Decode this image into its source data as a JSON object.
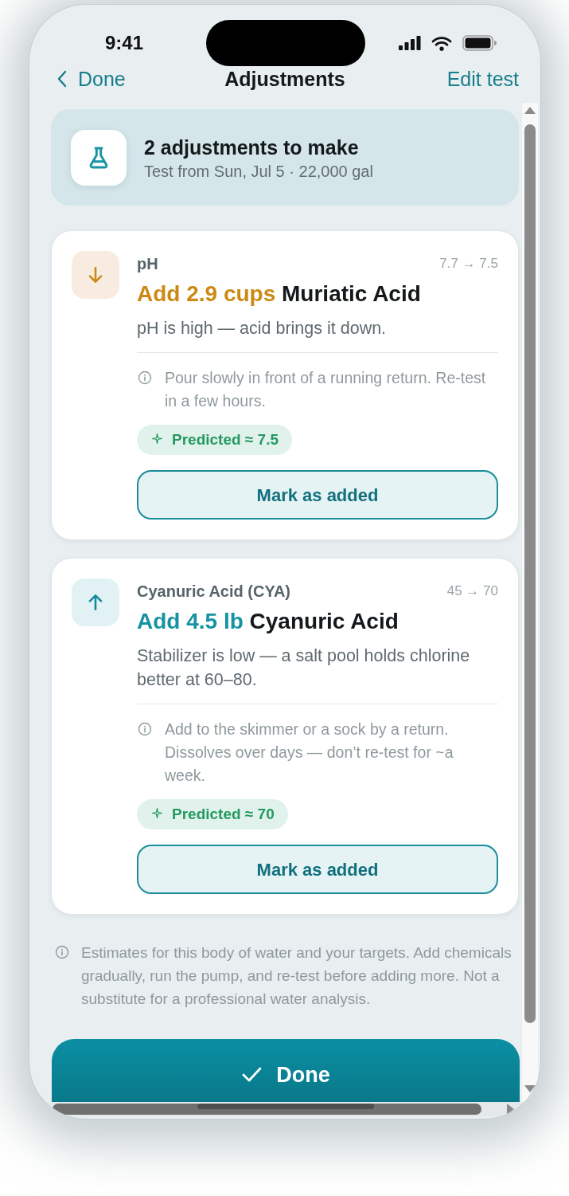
{
  "status_bar": {
    "time": "9:41"
  },
  "nav": {
    "back_label": "Done",
    "title": "Adjustments",
    "action": "Edit test"
  },
  "summary": {
    "title": "2 adjustments to make",
    "subtitle": "Test from Sun, Jul 5 · 22,000 gal"
  },
  "adjustments": [
    {
      "kind": "lower",
      "parameter": "pH",
      "reading": "7.7 → 7.5",
      "amount": "Add 2.9 cups",
      "chemical": "Muriatic Acid",
      "reason": "pH is high — acid brings it down.",
      "note": "Pour slowly in front of a running return. Re-test in a few hours.",
      "prediction": "Predicted ≈ 7.5",
      "button": "Mark as added"
    },
    {
      "kind": "raise",
      "parameter": "Cyanuric Acid (CYA)",
      "reading": "45 → 70",
      "amount": "Add 4.5 lb",
      "chemical": "Cyanuric Acid",
      "reason": "Stabilizer is low — a salt pool holds chlorine better at 60–80.",
      "note": "Add to the skimmer or a sock by a return. Dissolves over days — don’t re-test for ~a week.",
      "prediction": "Predicted ≈ 70",
      "button": "Mark as added"
    }
  ],
  "disclaimer": "Estimates for this body of water and your targets. Add chemicals gradually, run the pump, and re-test before adding more. Not a substitute for a professional water analysis.",
  "primary_button": "Done"
}
